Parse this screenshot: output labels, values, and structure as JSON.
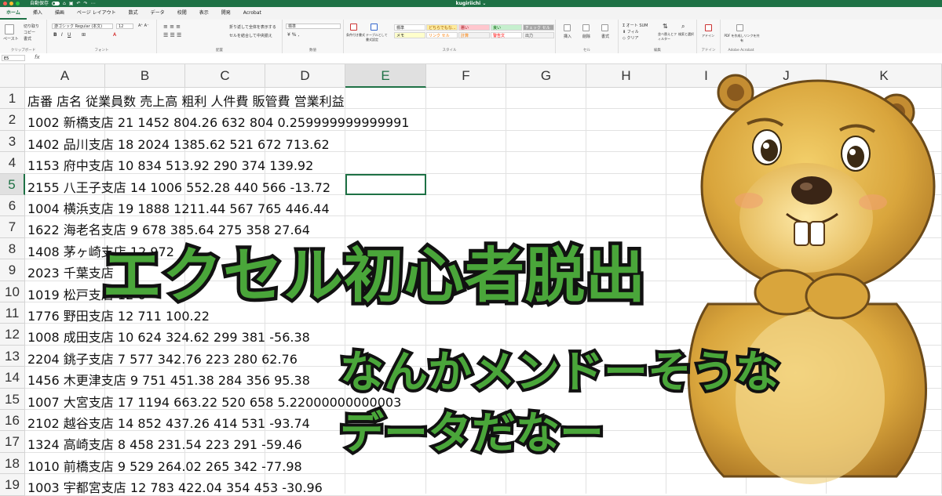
{
  "window": {
    "autosave_label": "自動保存",
    "title": "kugiriichi ⌄",
    "traffic_colors": [
      "#ff5f57",
      "#febc2e",
      "#28c840"
    ]
  },
  "menu": [
    "ホーム",
    "挿入",
    "描画",
    "ページ レイアウト",
    "数式",
    "データ",
    "校閲",
    "表示",
    "開発",
    "Acrobat"
  ],
  "ribbon": {
    "clipboard": {
      "paste": "ペースト",
      "cut": "切り取り",
      "copy": "コピー",
      "format": "書式",
      "caption": "クリップボード"
    },
    "font": {
      "name": "游ゴシック Regular (本文)",
      "size": "12",
      "caption": "フォント"
    },
    "align": {
      "wrap": "折り返して全体を表示する",
      "merge": "セルを結合して中央揃え",
      "caption": "配置"
    },
    "number": {
      "format": "標準",
      "caption": "数値"
    },
    "styles": {
      "cond": "条件付き書式",
      "table": "テーブルとして書式設定",
      "chips": [
        {
          "label": "標準",
          "bg": "#ffffff",
          "fg": "#222222"
        },
        {
          "label": "どちらでもな...",
          "bg": "#ffeb9c",
          "fg": "#9c5700"
        },
        {
          "label": "悪い",
          "bg": "#ffc7ce",
          "fg": "#9c0006"
        },
        {
          "label": "良い",
          "bg": "#c6efce",
          "fg": "#006100"
        },
        {
          "label": "チェック セル",
          "bg": "#a5a5a5",
          "fg": "#ffffff"
        },
        {
          "label": "メモ",
          "bg": "#ffffcc",
          "fg": "#222222"
        },
        {
          "label": "リンク セル",
          "bg": "#ffffff",
          "fg": "#fa7d00"
        },
        {
          "label": "計算",
          "bg": "#f2f2f2",
          "fg": "#fa7d00"
        },
        {
          "label": "警告文",
          "bg": "#ffffff",
          "fg": "#ff0000"
        },
        {
          "label": "出力",
          "bg": "#f2f2f2",
          "fg": "#3f3f3f"
        }
      ],
      "caption": "スタイル"
    },
    "cells": {
      "insert": "挿入",
      "delete": "削除",
      "format": "書式",
      "caption": "セル"
    },
    "editing": {
      "autosum": "オート SUM",
      "fill": "フィル",
      "clear": "クリア",
      "sort": "並べ替えとフィルター",
      "find": "検索と選択",
      "caption": "編集"
    },
    "addins": {
      "label": "アドイン",
      "caption": "アドイン"
    },
    "acrobat": {
      "label": "PDF を作成しリンクを共有",
      "caption": "Adobe Acrobat"
    }
  },
  "formula_bar": {
    "name_box": "E5",
    "fx": "fx",
    "value": ""
  },
  "columns": [
    "A",
    "B",
    "C",
    "D",
    "E",
    "F",
    "G",
    "H",
    "I",
    "J",
    "K"
  ],
  "selected_column": "E",
  "selected_row": "5",
  "rows": [
    {
      "n": "1",
      "text": "店番 店名 従業員数 売上高 粗利 人件費 販管費 営業利益"
    },
    {
      "n": "2",
      "text": "1002 新橋支店 21 1452 804.26 632 804 0.259999999999991"
    },
    {
      "n": "3",
      "text": "1402 品川支店 18 2024 1385.62 521 672 713.62"
    },
    {
      "n": "4",
      "text": "1153 府中支店 10 834 513.92 290 374 139.92"
    },
    {
      "n": "5",
      "text": "2155 八王子支店 14 1006 552.28 440 566 -13.72"
    },
    {
      "n": "6",
      "text": "1004 横浜支店 19 1888 1211.44 567 765 446.44"
    },
    {
      "n": "7",
      "text": "1622 海老名支店 9 678 385.64 275 358 27.64"
    },
    {
      "n": "8",
      "text": "1408 茅ヶ崎支店 12 972"
    },
    {
      "n": "9",
      "text": "2023 千葉支店"
    },
    {
      "n": "10",
      "text": "1019 松戸支店 12 6"
    },
    {
      "n": "11",
      "text": "1776 野田支店 12 711 100.22"
    },
    {
      "n": "12",
      "text": "1008 成田支店 10 624 324.62 299 381 -56.38"
    },
    {
      "n": "13",
      "text": "2204 銚子支店 7 577 342.76 223 280 62.76"
    },
    {
      "n": "14",
      "text": "1456 木更津支店 9 751 451.38 284 356 95.38"
    },
    {
      "n": "15",
      "text": "1007 大宮支店 17 1194 663.22 520 658 5.22000000000003"
    },
    {
      "n": "16",
      "text": "2102 越谷支店 14 852 437.26 414 531 -93.74"
    },
    {
      "n": "17",
      "text": "1324 高崎支店 8 458 231.54 223 291 -59.46"
    },
    {
      "n": "18",
      "text": "1010 前橋支店 9 529 264.02 265 342 -77.98"
    },
    {
      "n": "19",
      "text": "1003 宇都宮支店 12 783 422.04 354 453 -30.96"
    }
  ],
  "overlay": {
    "headline": "エクセル初心者脱出",
    "sub_line1": "なんかメンドーそうな",
    "sub_line2": "データだなー",
    "text_color": "#4aa63a",
    "outline_color": "#111111"
  },
  "mascot": {
    "icon": "beaver-mascot-illustration"
  }
}
